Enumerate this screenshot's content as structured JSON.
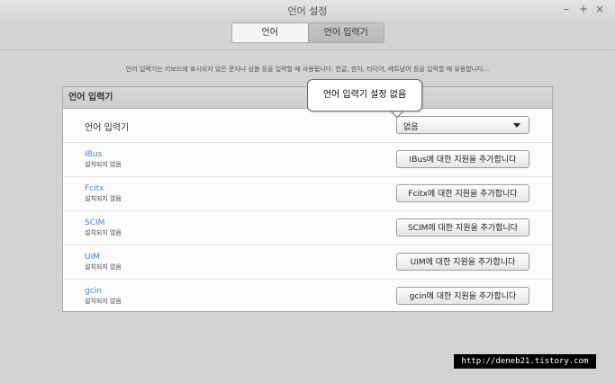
{
  "window": {
    "title": "언어 설정",
    "controls": [
      "–",
      "+",
      "×"
    ]
  },
  "tabs": [
    {
      "label": "언어",
      "active": false
    },
    {
      "label": "언어 입력기",
      "active": true
    }
  ],
  "description": "언어 입력기는 키보드에 표시되지 않은 문자나 심볼 등을 입력할 때 사용됩니다. 한글, 한자, 타이어, 베트남어 등을 입력할 때 유용합니다...",
  "panel": {
    "header": "언어 입력기",
    "selector": {
      "label": "언어 입력기",
      "value": "없음"
    },
    "methods": [
      {
        "name": "IBus",
        "status": "설치되지 않음",
        "button": "IBus에 대한 지원을 추가합니다"
      },
      {
        "name": "Fcitx",
        "status": "설치되지 않음",
        "button": "Fcitx에 대한 지원을 추가합니다"
      },
      {
        "name": "SCIM",
        "status": "설치되지 않음",
        "button": "SCIM에 대한 지원을 추가합니다"
      },
      {
        "name": "UIM",
        "status": "설치되지 않음",
        "button": "UIM에 대한 지원을 추가합니다"
      },
      {
        "name": "gcin",
        "status": "설치되지 않음",
        "button": "gcin에 대한 지원을 추가합니다"
      }
    ]
  },
  "tooltip": "언어 입력기 설정 없음",
  "watermark": "http://deneb21.tistory.com"
}
